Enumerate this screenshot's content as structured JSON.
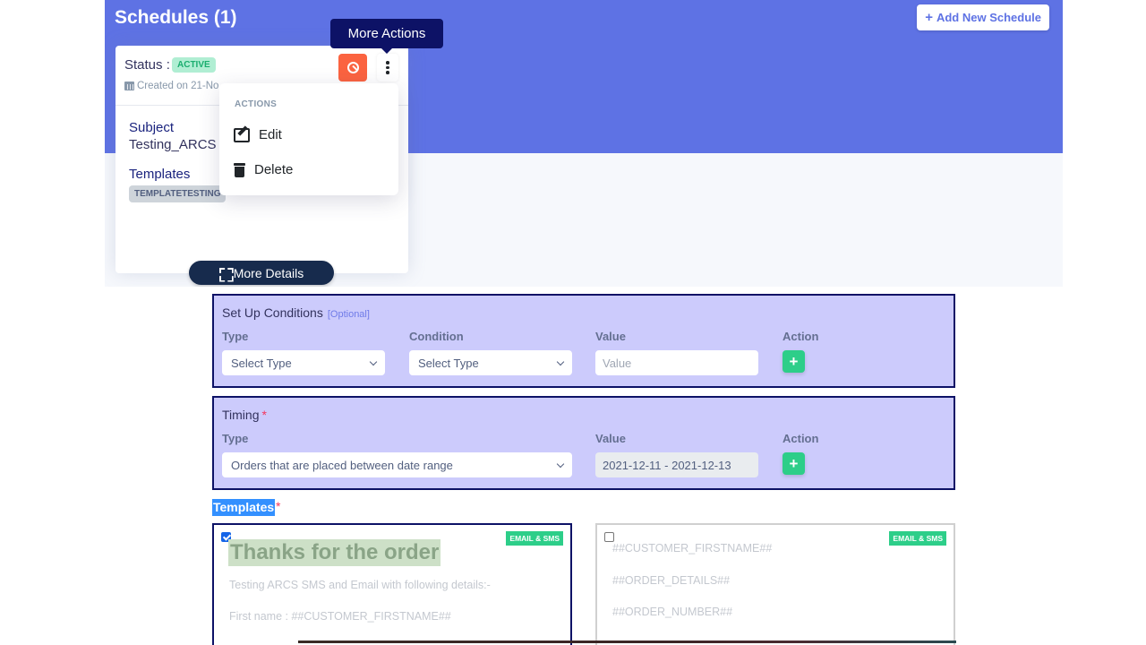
{
  "header": {
    "title": "Schedules (1)",
    "add_button": "Add New Schedule"
  },
  "schedule_card": {
    "status_label": "Status :",
    "status_badge": "ACTIVE",
    "created": "Created on 21-No",
    "subject_label": "Subject",
    "subject_value": "Testing_ARCS",
    "templates_label": "Templates",
    "template_chip": "TEMPLATETESTING",
    "more_details": "More Details"
  },
  "tooltip": "More Actions",
  "actions_menu": {
    "header": "ACTIONS",
    "items": [
      {
        "label": "Edit",
        "icon": "edit-icon"
      },
      {
        "label": "Delete",
        "icon": "trash-icon"
      }
    ]
  },
  "conditions": {
    "title": "Set Up Conditions",
    "optional": "[Optional]",
    "columns": [
      "Type",
      "Condition",
      "Value",
      "Action"
    ],
    "type_select": "Select Type",
    "condition_select": "Select Type",
    "value_placeholder": "Value",
    "add_label": "+"
  },
  "timing": {
    "title": "Timing",
    "required": "*",
    "columns": [
      "Type",
      "Value",
      "Action"
    ],
    "type_select": "Orders that are placed between date range",
    "value": "2021-12-11 - 2021-12-13",
    "add_label": "+"
  },
  "templates": {
    "heading": "Templates",
    "required": "*",
    "cards": [
      {
        "checked": true,
        "badge": "EMAIL & SMS",
        "headline": "Thanks for the order",
        "lines": [
          "Testing ARCS SMS and Email with following details:-",
          "First name : ##CUSTOMER_FIRSTNAME##"
        ]
      },
      {
        "checked": false,
        "badge": "EMAIL & SMS",
        "lines": [
          "##CUSTOMER_FIRSTNAME##",
          "##ORDER_DETAILS##",
          "##ORDER_NUMBER##"
        ]
      }
    ]
  },
  "colors": {
    "primary": "#5e72e4",
    "danger": "#fb6340",
    "success": "#2dce89",
    "section_bg": "#cccbfc",
    "section_border": "#0d1266"
  }
}
